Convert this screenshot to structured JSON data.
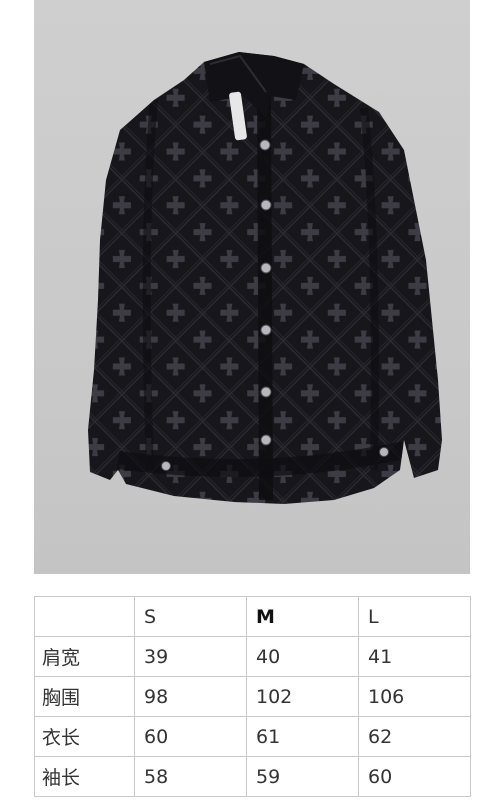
{
  "image": {
    "subject": "black-velvet-cross-pattern-button-shirt-icon"
  },
  "size_chart": {
    "headers": [
      "",
      "S",
      "M",
      "L"
    ],
    "rows": [
      {
        "label": "肩宽",
        "values": [
          "39",
          "40",
          "41"
        ]
      },
      {
        "label": "胸围",
        "values": [
          "98",
          "102",
          "106"
        ]
      },
      {
        "label": "衣长",
        "values": [
          "60",
          "61",
          "62"
        ]
      },
      {
        "label": "袖长",
        "values": [
          "58",
          "59",
          "60"
        ]
      }
    ]
  },
  "colors": {
    "photo_bg": "#cccccc",
    "shirt": "#151419",
    "pattern": "#3a3a42",
    "table_border": "#c8c8c8"
  }
}
